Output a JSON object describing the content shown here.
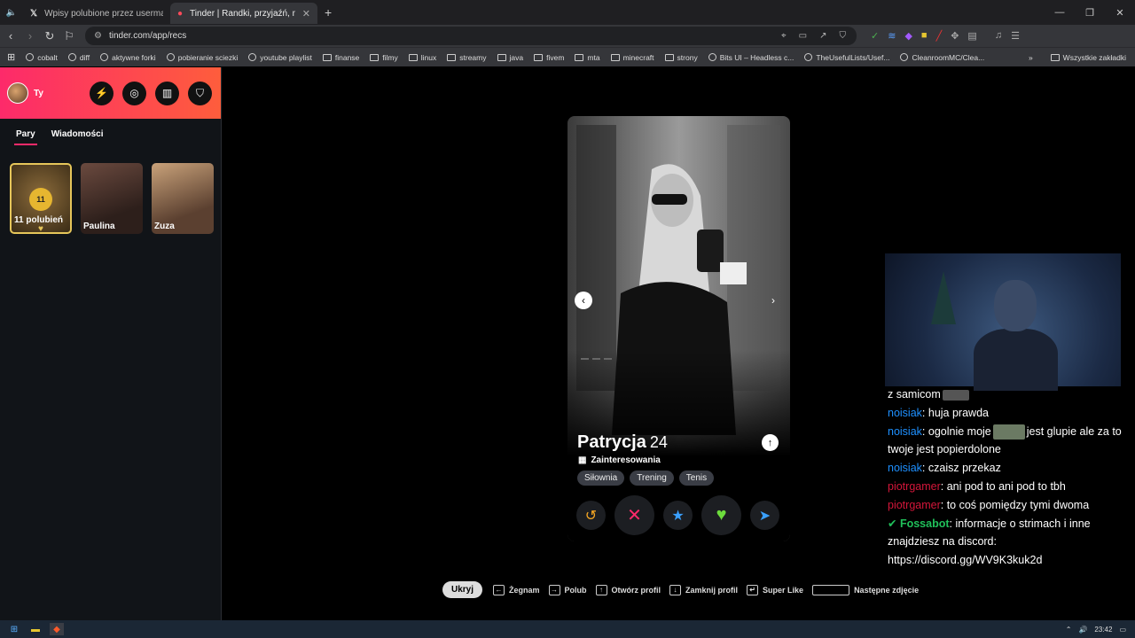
{
  "browser": {
    "tabs": [
      {
        "label": "Wpisy polubione przez usermacieg (@",
        "icon": "x-logo"
      },
      {
        "label": "Tinder | Randki, przyjaźń, nowe zna",
        "icon": "tinder-flame"
      }
    ],
    "new_tab": "+",
    "url": "tinder.com/app/recs",
    "bookmarks": [
      "cobalt",
      "diff",
      "aktywne forki",
      "pobieranie sciezki",
      "youtube playlist",
      "finanse",
      "filmy",
      "linux",
      "streamy",
      "java",
      "fivem",
      "mta",
      "minecraft",
      "strony",
      "Bits UI – Headless c...",
      "TheUsefulLists/Usef...",
      "CleanroomMC/Clea..."
    ],
    "bookmarks_more": "»",
    "all_bookmarks": "Wszystkie zakładki"
  },
  "sidebar": {
    "user_name": "Ty",
    "tabs": [
      "Pary",
      "Wiadomości"
    ],
    "likes_count": "11",
    "likes_label": "11 polubień",
    "matches": [
      "Paulina",
      "Zuza"
    ]
  },
  "profile": {
    "name": "Patrycja",
    "age": "24",
    "interests_label": "Zainteresowania",
    "tags": [
      "Siłownia",
      "Trening",
      "Tenis"
    ]
  },
  "chat": [
    {
      "user": "",
      "text": "z samicom",
      "color": "#ffffff",
      "emote": true
    },
    {
      "user": "noisiak",
      "text": ": huja prawda",
      "color": "#1e90ff"
    },
    {
      "user": "noisiak",
      "text": ": ogolnie moje",
      "after": "jest glupie ale za to twoje jest popierdolone",
      "color": "#1e90ff",
      "emote": true
    },
    {
      "user": "noisiak",
      "text": ": czaisz przekaz",
      "color": "#1e90ff"
    },
    {
      "user": "piotrgamer",
      "text": ": ani pod to ani pod to tbh",
      "color": "#d4163a"
    },
    {
      "user": "piotrgamer",
      "text": ": to coś pomiędzy tymi dwoma",
      "color": "#d4163a"
    },
    {
      "user": "Fossabot",
      "text": ": informacje o strimach i inne znajdziesz na discord: https://discord.gg/WV9K3kuk2d",
      "color": "#20c05a"
    }
  ],
  "hints": {
    "hide": "Ukryj",
    "items": [
      {
        "key": "←",
        "label": "Żegnam"
      },
      {
        "key": "→",
        "label": "Polub"
      },
      {
        "key": "↑",
        "label": "Otwórz profil"
      },
      {
        "key": "↓",
        "label": "Zamknij profil"
      },
      {
        "key": "↵",
        "label": "Super Like"
      },
      {
        "key": "",
        "label": "Następne zdjęcie",
        "wide": true
      }
    ]
  },
  "taskbar": {
    "time": "23:42"
  }
}
